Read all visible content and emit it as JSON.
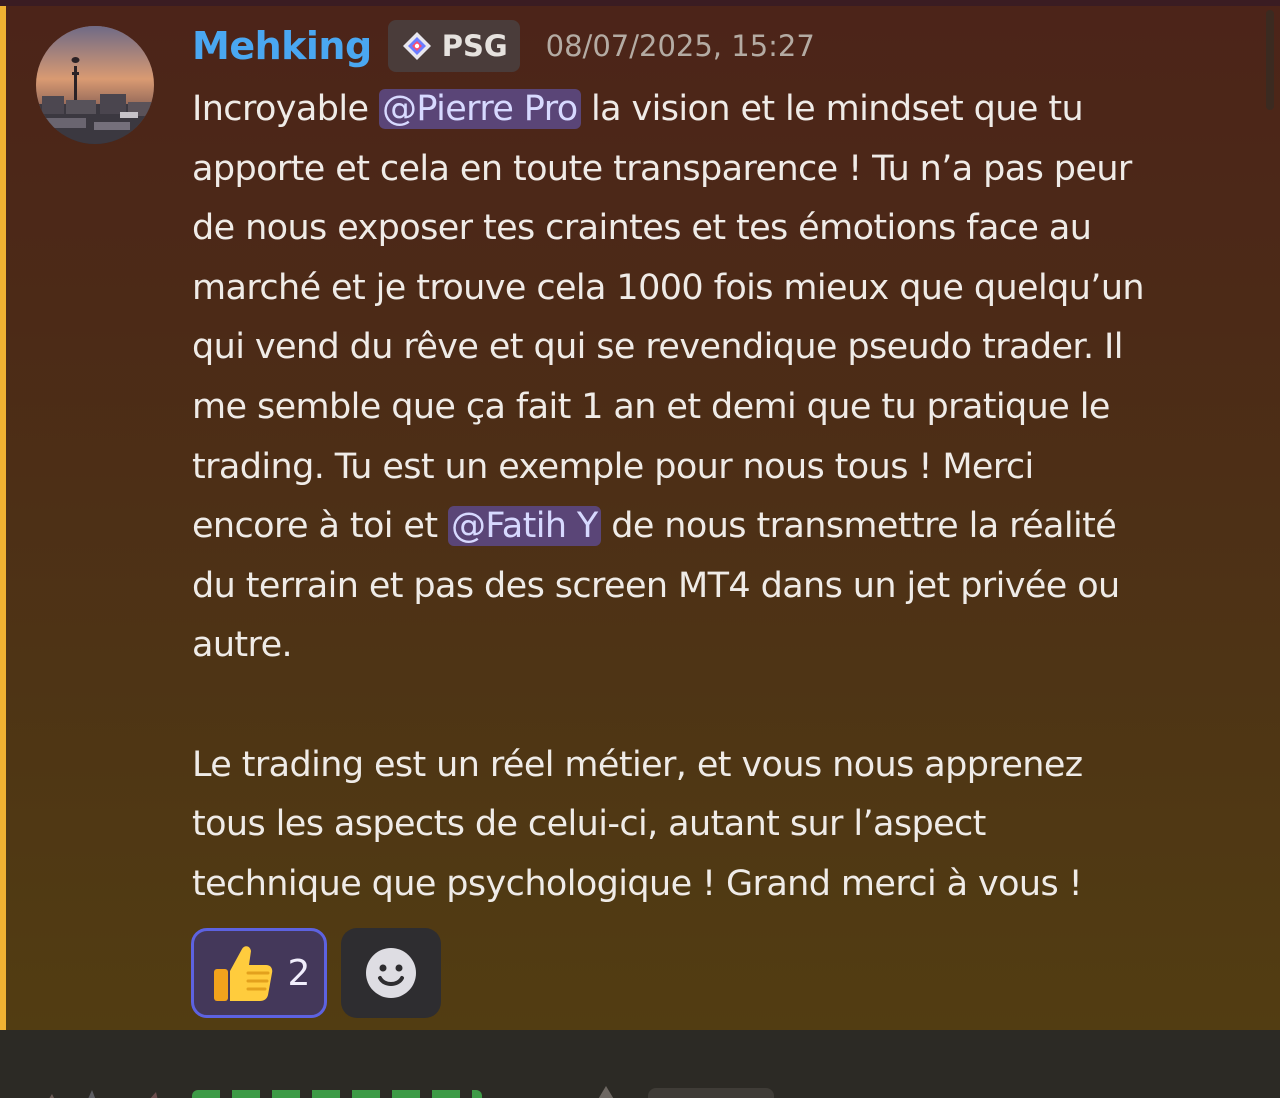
{
  "message": {
    "author": "Mehking",
    "tag": "PSG",
    "timestamp": "08/07/2025, 15:27",
    "content": {
      "line1_pre": "Incroyable ",
      "mention1": "@Pierre Pro",
      "line1_post": " la vision et le mindset que tu",
      "line2": "apporte et cela en toute transparence ! Tu n’a pas peur",
      "line3": "de nous exposer tes craintes et tes émotions face au",
      "line4": "marché et je trouve cela 1000 fois mieux que quelqu’un",
      "line5": "qui vend du rêve et qui se revendique pseudo trader. Il",
      "line6": "me semble que ça fait 1 an et demi que tu pratique le",
      "line7": "trading. Tu est un exemple pour nous tous ! Merci",
      "line8_pre": "encore à toi et ",
      "mention2": "@Fatih Y",
      "line8_post": " de nous transmettre la réalité",
      "line9": "du terrain et pas des screen MT4 dans un jet privée ou",
      "line10": "autre.",
      "para2_line1": "Le trading est un réel métier, et vous nous apprenez",
      "para2_line2": "tous les aspects de celui-ci, autant sur l’aspect",
      "para2_line3": "technique que psychologique ! Grand merci à vous !"
    },
    "reactions": [
      {
        "emoji_icon": "thumbs-up-icon",
        "count": "2",
        "active": true
      },
      {
        "emoji_icon": "add-reaction-smiley-icon",
        "count": ""
      }
    ]
  },
  "colors": {
    "username": "#4aa7f1",
    "mention_bg": "#5a4577",
    "mention_text": "#d7d9ff",
    "highlight_bar": "#f0b232",
    "reaction_active_border": "#5d62e0"
  }
}
